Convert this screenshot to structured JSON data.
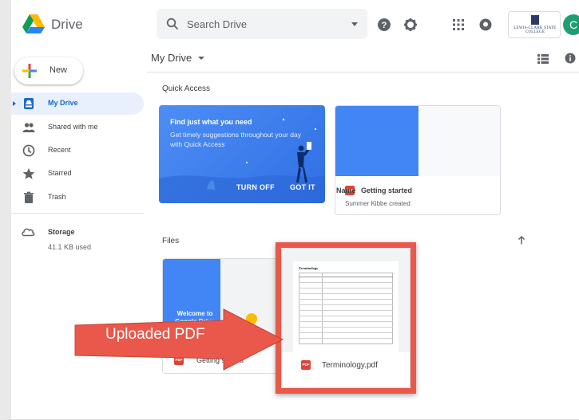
{
  "header": {
    "app_title": "Drive",
    "search_placeholder": "Search Drive",
    "org_name": "LEWIS-CLARK STATE COLLEGE",
    "avatar_letter": "C"
  },
  "sidebar": {
    "new_label": "New",
    "items": [
      {
        "label": "My Drive",
        "icon": "my-drive-icon",
        "active": true
      },
      {
        "label": "Shared with me",
        "icon": "people-icon"
      },
      {
        "label": "Recent",
        "icon": "clock-icon"
      },
      {
        "label": "Starred",
        "icon": "star-icon"
      },
      {
        "label": "Trash",
        "icon": "trash-icon"
      }
    ],
    "storage_label": "Storage",
    "storage_used": "41.1 KB used"
  },
  "main": {
    "breadcrumb": "My Drive",
    "quick_access_title": "Quick Access",
    "promo": {
      "title": "Find just what you need",
      "body": "Get timely suggestions throughout your day with Quick Access",
      "turn_off": "TURN OFF",
      "got_it": "GOT IT"
    },
    "quick_card": {
      "name": "Getting started",
      "subtitle": "Summer Kibbe created",
      "badge": "PDF"
    },
    "files_title": "Files",
    "sort_label": "Name",
    "files": [
      {
        "name": "Getting started",
        "thumb_text": "Welcome to Google Drive",
        "badge": "PDF"
      },
      {
        "name": "Terminology.pdf",
        "doc_title": "Terminology",
        "badge": "PDF"
      }
    ]
  },
  "annotation": {
    "label": "Uploaded PDF",
    "color": "#e9584b"
  },
  "colors": {
    "accent": "#1967d2",
    "active_bg": "#e8f0fe",
    "promo_blue": "#3b7ded",
    "pdf_red": "#db4437"
  }
}
